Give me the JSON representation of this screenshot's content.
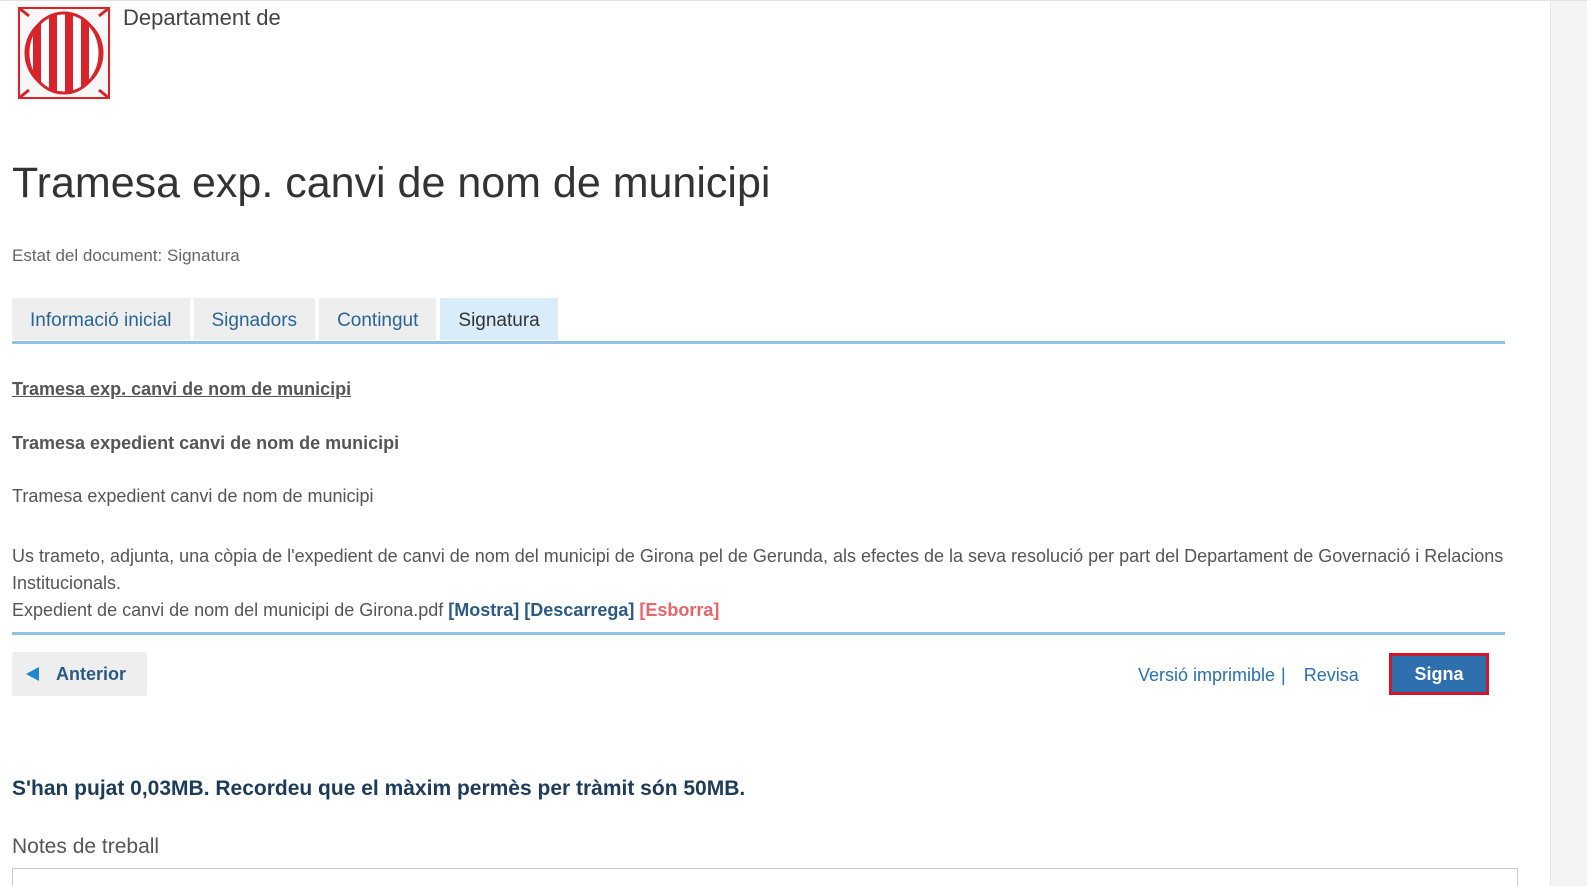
{
  "header": {
    "department": "Departament de"
  },
  "page": {
    "title": "Tramesa exp. canvi de nom de municipi",
    "status": "Estat del document: Signatura"
  },
  "tabs": [
    {
      "label": "Informació inicial",
      "active": false
    },
    {
      "label": "Signadors",
      "active": false
    },
    {
      "label": "Contingut",
      "active": false
    },
    {
      "label": "Signatura",
      "active": true
    }
  ],
  "document": {
    "link_title": "Tramesa exp. canvi de nom de municipi",
    "subtitle": "Tramesa expedient canvi de nom de municipi",
    "description": "Tramesa expedient canvi de nom de municipi",
    "body": "Us trameto, adjunta, una còpia de l'expedient de canvi de nom del municipi de Girona pel de Gerunda, als efectes de la seva resolució per part del Departament de Governació i Relacions Institucionals.",
    "attachment": {
      "filename": "Expedient de canvi de nom del municipi de Girona.pdf",
      "show_label": "[Mostra]",
      "download_label": "[Descarrega]",
      "delete_label": "[Esborra]"
    }
  },
  "footer_actions": {
    "previous_label": "Anterior",
    "printable_label": "Versió imprimible",
    "separator": "|",
    "review_label": "Revisa",
    "sign_label": "Signa"
  },
  "upload_note": "S'han pujat 0,03MB. Recordeu que el màxim permès per tràmit són 50MB.",
  "notes": {
    "label": "Notes de treball"
  },
  "colors": {
    "accent_blue": "#2e6fae",
    "tab_active_bg": "#d9ecf9",
    "rule": "#8fc3e6",
    "highlight_red": "#d0172c",
    "delete_red": "#e8656a",
    "logo_red": "#d8232a"
  }
}
